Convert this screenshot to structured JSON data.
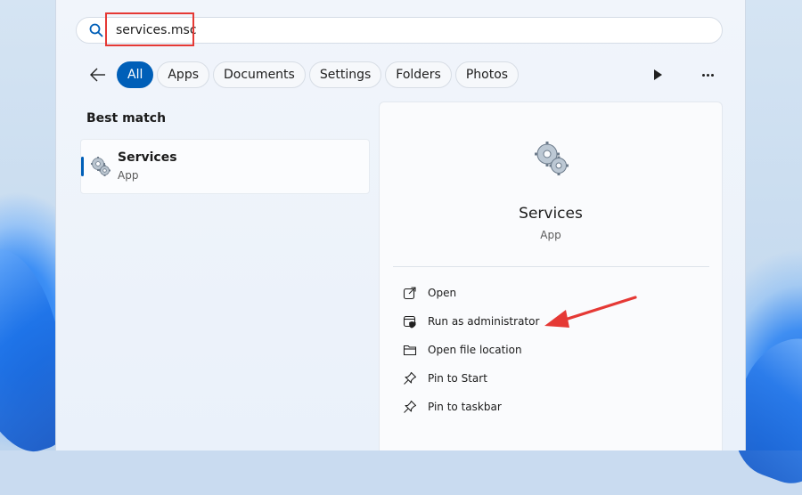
{
  "search": {
    "value": "services.msc",
    "placeholder": ""
  },
  "filters": [
    {
      "label": "All",
      "active": true
    },
    {
      "label": "Apps",
      "active": false
    },
    {
      "label": "Documents",
      "active": false
    },
    {
      "label": "Settings",
      "active": false
    },
    {
      "label": "Folders",
      "active": false
    },
    {
      "label": "Photos",
      "active": false
    }
  ],
  "best_match": {
    "title": "Best match",
    "item": {
      "name": "Services",
      "type": "App",
      "icon": "services-gears-icon"
    }
  },
  "detail": {
    "name": "Services",
    "type": "App",
    "icon": "services-gears-icon",
    "actions": [
      {
        "label": "Open",
        "icon": "open-external-icon"
      },
      {
        "label": "Run as administrator",
        "icon": "shield-admin-icon"
      },
      {
        "label": "Open file location",
        "icon": "folder-icon"
      },
      {
        "label": "Pin to Start",
        "icon": "pin-icon"
      },
      {
        "label": "Pin to taskbar",
        "icon": "pin-icon"
      }
    ]
  },
  "colors": {
    "accent": "#005fb8",
    "annotation": "#e53935"
  }
}
